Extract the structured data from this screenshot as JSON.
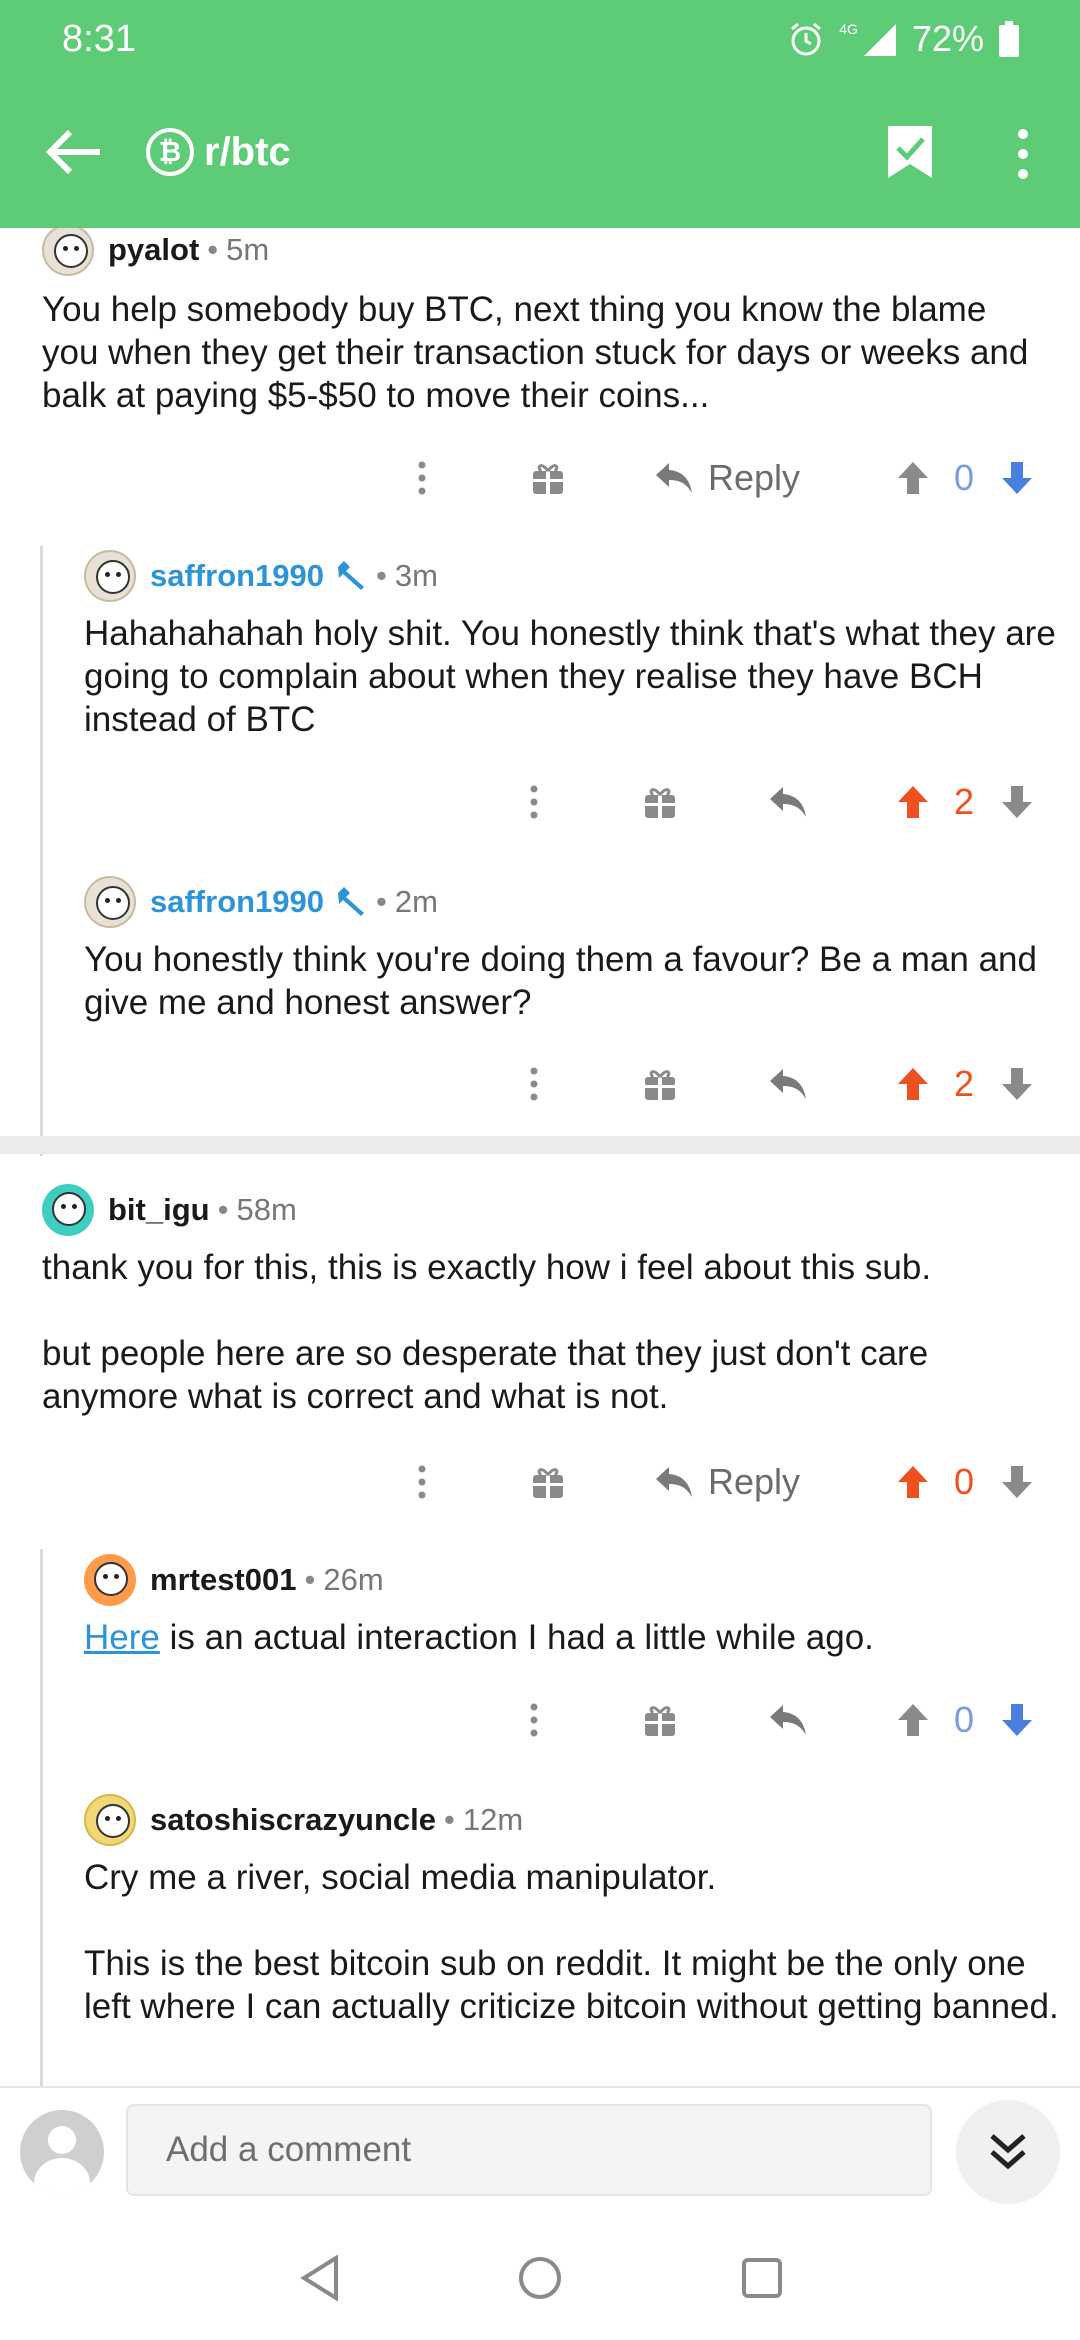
{
  "status_bar": {
    "time": "8:31",
    "network": "4G",
    "battery": "72%"
  },
  "header": {
    "subreddit": "r/btc",
    "badge": "₿"
  },
  "comments": [
    {
      "author": "pyalot",
      "age": "5m",
      "body": [
        "You help somebody buy BTC, next thing you know the blame you when they get their transaction stuck for days or weeks and balk at paying $5-$50 to move their coins..."
      ],
      "reply_label": "Reply",
      "score": "0",
      "vote": "none"
    },
    {
      "author": "saffron1990",
      "age": "3m",
      "body": [
        "Hahahahahah holy shit. You honestly think that's what they are going to complain about when they realise they have BCH instead of BTC"
      ],
      "score": "2",
      "vote": "up"
    },
    {
      "author": "saffron1990",
      "age": "2m",
      "body": [
        "You honestly think you're doing them a favour? Be a man and give me and honest answer?"
      ],
      "score": "2",
      "vote": "up"
    },
    {
      "author": "bit_igu",
      "age": "58m",
      "body": [
        "thank you for this, this is exactly how i feel about this sub.",
        "but people here are so desperate that they just don't care anymore what is correct and what is not."
      ],
      "reply_label": "Reply",
      "score": "0",
      "vote": "up"
    },
    {
      "author": "mrtest001",
      "age": "26m",
      "link_text": "Here",
      "body": [
        " is an actual interaction I had a little while ago."
      ],
      "score": "0",
      "vote": "none"
    },
    {
      "author": "satoshiscrazyuncle",
      "age": "12m",
      "body": [
        "Cry me a river, social media manipulator.",
        "This is the best bitcoin sub on reddit.  It might be the only one left where I can actually criticize bitcoin without getting banned."
      ]
    }
  ],
  "separator": "•",
  "bottom_bar": {
    "placeholder": "Add a comment"
  },
  "colors": {
    "header_green": "#5ecb76",
    "upvote_orange": "#ef5020",
    "link_blue": "#2c94d8",
    "score_blue": "#7a9de0"
  }
}
